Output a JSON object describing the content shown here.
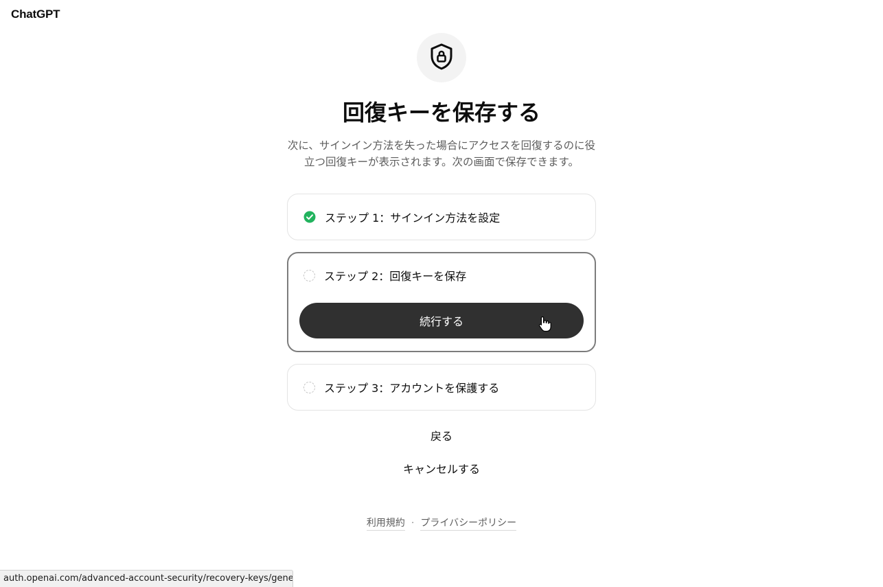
{
  "app": {
    "brand": "ChatGPT"
  },
  "header": {
    "title": "回復キーを保存する",
    "subtitle": "次に、サインイン方法を失った場合にアクセスを回復するのに役立つ回復キーが表示されます。次の画面で保存できます。"
  },
  "icons": {
    "hero": "shield-lock-icon",
    "completed": "check-circle-icon",
    "pending": "dashed-circle-icon",
    "cursor": "hand-pointer-cursor-icon"
  },
  "colors": {
    "success": "#10a37f",
    "primary_button": "#303030",
    "active_border": "#7c7c7c"
  },
  "steps": [
    {
      "label": "ステップ 1：サインイン方法を設定",
      "status": "completed"
    },
    {
      "label": "ステップ 2：回復キーを保存",
      "status": "active"
    },
    {
      "label": "ステップ 3：アカウントを保護する",
      "status": "pending"
    }
  ],
  "actions": {
    "continue_label": "続行する",
    "back_label": "戻る",
    "cancel_label": "キャンセルする"
  },
  "footer": {
    "terms_label": "利用規約",
    "separator": "·",
    "privacy_label": "プライバシーポリシー"
  },
  "status_bar": {
    "url": "auth.openai.com/advanced-account-security/recovery-keys/gene..."
  }
}
